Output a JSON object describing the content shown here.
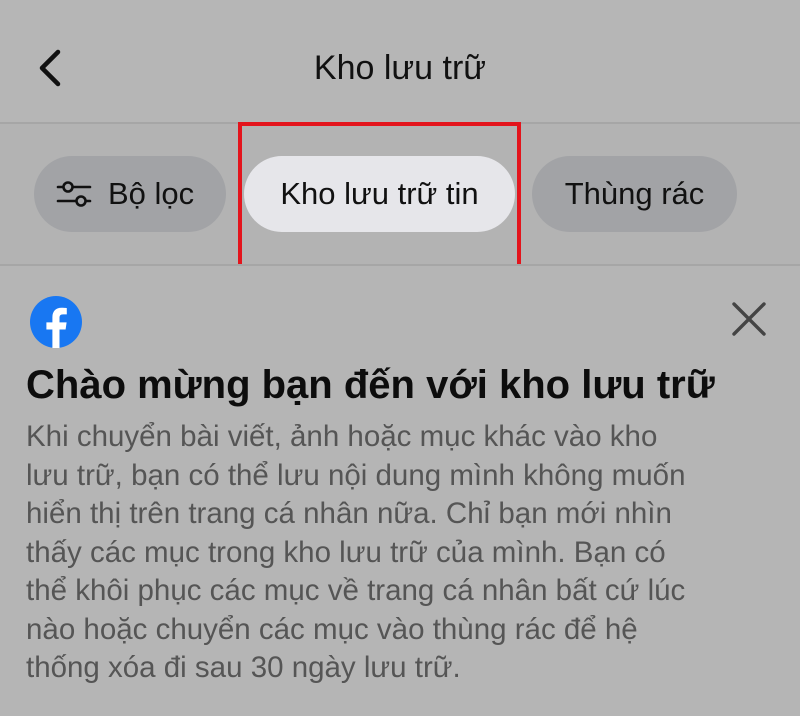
{
  "header": {
    "title": "Kho lưu trữ"
  },
  "chips": {
    "filter": "Bộ lọc",
    "archive": "Kho lưu trữ tin",
    "trash": "Thùng rác"
  },
  "card": {
    "title": "Chào mừng bạn đến với kho lưu trữ",
    "body_lines": [
      "Khi chuyển bài viết, ảnh hoặc mục khác vào kho",
      "lưu trữ, bạn có thể lưu nội dung mình không muốn",
      "hiển thị trên trang cá nhân nữa. Chỉ bạn mới nhìn",
      "thấy các mục trong kho lưu trữ của mình. Bạn có",
      "thể khôi phục các mục về trang cá nhân bất cứ lúc",
      "nào hoặc chuyển các mục vào thùng rác để hệ",
      "thống xóa đi sau 30 ngày lưu trữ."
    ]
  },
  "colors": {
    "highlight": "#e3141c",
    "facebook_blue": "#1877f2",
    "selected_chip": "#e6e6ea",
    "chip": "#a2a3a6"
  },
  "icons": {
    "back": "chevron-left-icon",
    "filter": "sliders-icon",
    "logo": "facebook-logo-icon",
    "close": "close-icon"
  }
}
